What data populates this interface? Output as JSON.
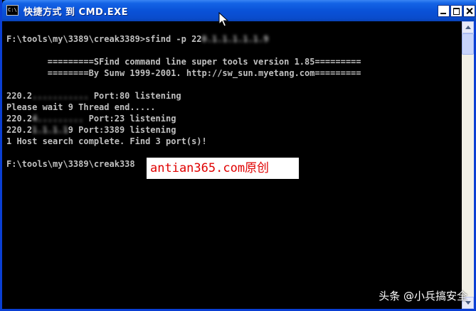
{
  "window": {
    "title": "快捷方式 到 CMD.EXE",
    "icon": "cmd-icon",
    "icon_text": "C:\\",
    "controls": {
      "minimize": "minimize-icon",
      "maximize": "maximize-icon",
      "close": "close-icon"
    }
  },
  "console": {
    "lines": [
      {
        "before": "F:\\tools\\my\\3389\\creak3389>sfind -p 22",
        "blurred": "0.1.1.1.1.1.9",
        "after": ""
      },
      {
        "before": "",
        "blurred": "",
        "after": ""
      },
      {
        "before": "        =========SFind command line super tools version 1.85=========",
        "blurred": "",
        "after": ""
      },
      {
        "before": "        ========By Sunw 1999-2001. http://sw_sun.myetang.com=========",
        "blurred": "",
        "after": ""
      },
      {
        "before": "",
        "blurred": "",
        "after": ""
      },
      {
        "before": "220.2",
        "blurred": "...........",
        "after": " Port:80 listening"
      },
      {
        "before": "Please wait 9 Thread end.....",
        "blurred": "",
        "after": ""
      },
      {
        "before": "220.2",
        "blurred": "4.........",
        "after": " Port:23 listening"
      },
      {
        "before": "220.2",
        "blurred": "1.1.1.1",
        "after": "9 Port:3389 listening"
      },
      {
        "before": "1 Host search complete. Find 3 port(s)!",
        "blurred": "",
        "after": ""
      },
      {
        "before": "",
        "blurred": "",
        "after": ""
      },
      {
        "before": "F:\\tools\\my\\3389\\creak338",
        "blurred": "",
        "after": ""
      }
    ]
  },
  "overlay_text": "antian365.com原创",
  "watermark": "头条 @小兵搞安全",
  "colors": {
    "titlebar": "#0a52d8",
    "console_bg": "#000000",
    "console_text": "#c0c0c0",
    "overlay_text": "#e00000"
  }
}
